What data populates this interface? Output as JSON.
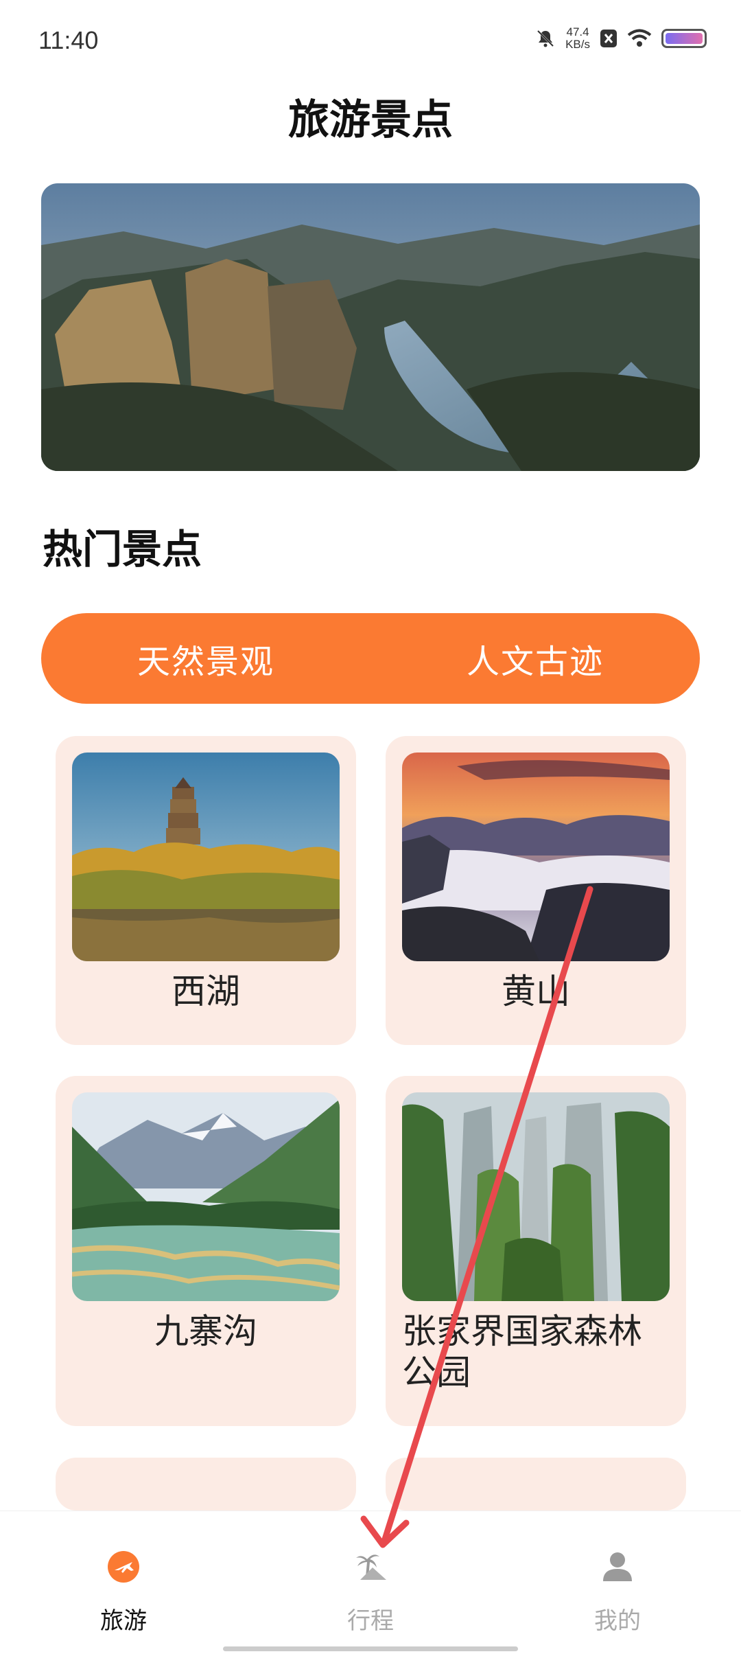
{
  "status_bar": {
    "time": "11:40",
    "net_speed_value": "47.4",
    "net_speed_unit": "KB/s"
  },
  "header": {
    "title": "旅游景点"
  },
  "section": {
    "title": "热门景点"
  },
  "tabs": [
    {
      "label": "天然景观"
    },
    {
      "label": "人文古迹"
    }
  ],
  "spots": [
    {
      "name": "西湖"
    },
    {
      "name": "黄山"
    },
    {
      "name": "九寨沟"
    },
    {
      "name": "张家界国家森林公园"
    }
  ],
  "bottom_nav": [
    {
      "label": "旅游",
      "icon": "plane-icon",
      "active": true
    },
    {
      "label": "行程",
      "icon": "palm-tree-icon",
      "active": false
    },
    {
      "label": "我的",
      "icon": "user-icon",
      "active": false
    }
  ],
  "colors": {
    "accent": "#fb7a32",
    "card_bg": "#fcebe4",
    "nav_inactive": "#aaaaaa",
    "nav_active": "#111111",
    "annotation_arrow": "#e8494d"
  }
}
